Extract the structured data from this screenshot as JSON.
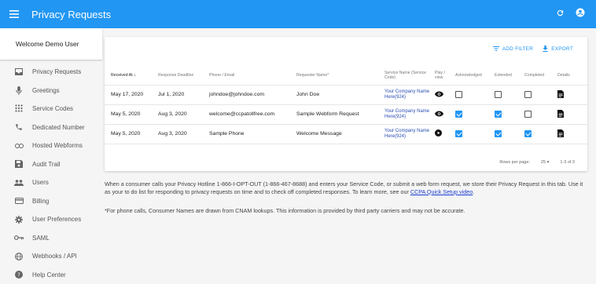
{
  "app": {
    "title": "Privacy Requests"
  },
  "sidebar": {
    "welcome": "Welcome Demo User",
    "items": [
      {
        "label": "Privacy Requests",
        "icon": "inbox-icon"
      },
      {
        "label": "Greetings",
        "icon": "microphone-icon"
      },
      {
        "label": "Service Codes",
        "icon": "dialpad-icon"
      },
      {
        "label": "Dedicated Number",
        "icon": "phone-icon"
      },
      {
        "label": "Hosted Webforms",
        "icon": "link-icon"
      },
      {
        "label": "Audit Trail",
        "icon": "save-icon"
      },
      {
        "label": "Users",
        "icon": "users-icon"
      },
      {
        "label": "Billing",
        "icon": "credit-card-icon"
      },
      {
        "label": "User Preferences",
        "icon": "gear-icon"
      },
      {
        "label": "SAML",
        "icon": "key-icon"
      },
      {
        "label": "Webhooks / API",
        "icon": "globe-icon"
      },
      {
        "label": "Help Center",
        "icon": "help-icon"
      }
    ]
  },
  "toolbar": {
    "add_filter": "ADD FILTER",
    "export": "EXPORT"
  },
  "table": {
    "headers": {
      "received": "Received At",
      "deadline": "Response Deadline",
      "contact": "Phone / Email",
      "requester": "Requester Name*",
      "service": "Service Name (Service Code)",
      "play": "Play / view",
      "ack": "Acknowledged",
      "ext": "Extended",
      "comp": "Completed",
      "details": "Details"
    },
    "rows": [
      {
        "received": "May 17, 2020",
        "deadline": "Jul 1, 2020",
        "contact": "johndoe@johndoe.com",
        "requester": "John Doe",
        "service": "Your Company Name Here(924)",
        "play": "eye",
        "ack": false,
        "ext": false,
        "comp": false
      },
      {
        "received": "May 5, 2020",
        "deadline": "Aug 3, 2020",
        "contact": "welcome@ccpatollfree.com",
        "requester": "Sample Webform Request",
        "service": "Your Company Name Here(924)",
        "play": "eye",
        "ack": true,
        "ext": true,
        "comp": false
      },
      {
        "received": "May 5, 2020",
        "deadline": "Aug 3, 2020",
        "contact": "Sample Phone",
        "requester": "Welcome Message",
        "service": "Your Company Name Here(924)",
        "play": "play",
        "ack": true,
        "ext": true,
        "comp": true
      }
    ]
  },
  "pagination": {
    "rows_label": "Rows per page:",
    "rows_value": "25",
    "range": "1-3 of 3"
  },
  "info": {
    "paragraph": "When a consumer calls your Privacy Hotline 1-866-I-OPT-OUT (1-866-467-8688) and enters your Service Code, or submit a web form request, we store their Privacy Request in this tab. Use it as your to do list for responding to privacy requests on time and to check off completed responses. To learn more, see our ",
    "link": "CCPA Quick Setup video",
    "after_link": ".",
    "note": "*For phone calls, Consumer Names are drawn from CNAM lookups. This information is provided by third party carriers and may not be accurate."
  },
  "colors": {
    "primary": "#2196f3",
    "link": "#1a3dd0"
  }
}
